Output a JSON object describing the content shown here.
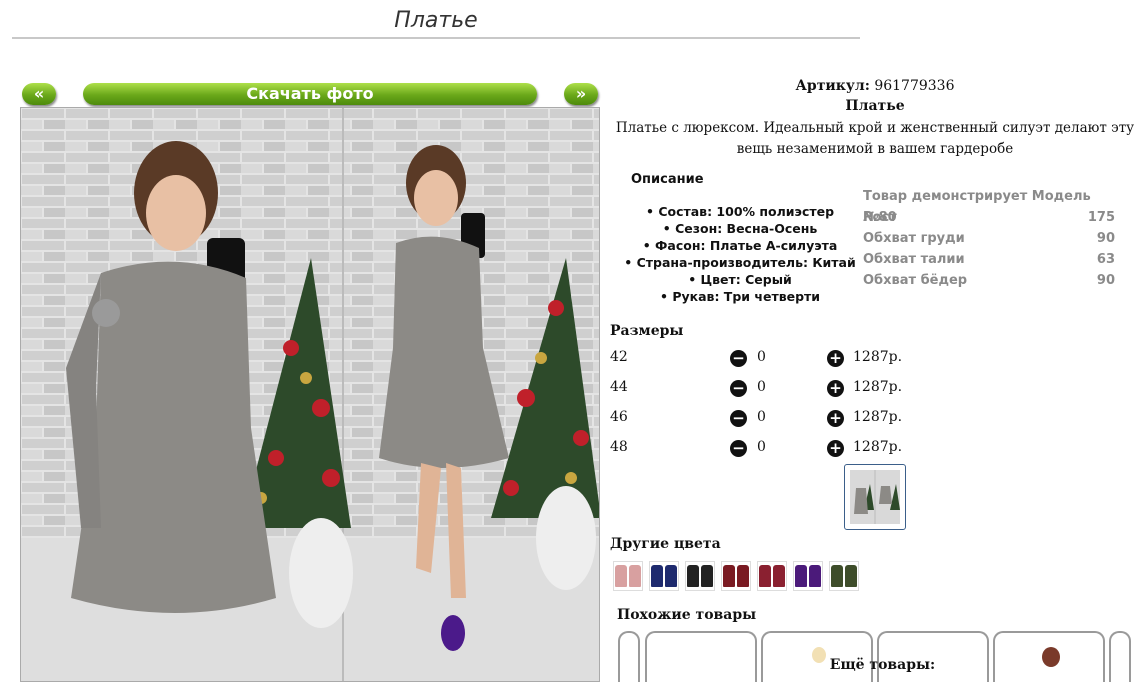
{
  "page": {
    "title": "Платье"
  },
  "gallery": {
    "prev_label": "«",
    "next_label": "»",
    "download_label": "Скачать фото"
  },
  "product": {
    "sku_label": "Артикул:",
    "sku_value": "961779336",
    "name": "Платье",
    "description": "Платье с люрексом. Идеальный крой и женственный силуэт делают эту вещь незаменимой в вашем гардеробе"
  },
  "attributes": {
    "heading": "Описание",
    "items": [
      "Состав: 100% полиэстер",
      "Сезон: Весна-Осень",
      "Фасон: Платье А-силуэта",
      "Страна-производитель: Китай",
      "Цвет: Серый",
      "Рукав: Три четверти"
    ]
  },
  "model": {
    "header": "Товар демонстрирует Модель №80",
    "rows": [
      {
        "label": "Рост",
        "value": "175"
      },
      {
        "label": "Обхват груди",
        "value": "90"
      },
      {
        "label": "Обхват талии",
        "value": "63"
      },
      {
        "label": "Обхват бёдер",
        "value": "90"
      }
    ]
  },
  "sizes": {
    "heading": "Размеры",
    "minus_symbol": "−",
    "plus_symbol": "+",
    "rows": [
      {
        "size": "42",
        "qty": "0",
        "price": "1287р."
      },
      {
        "size": "44",
        "qty": "0",
        "price": "1287р."
      },
      {
        "size": "46",
        "qty": "0",
        "price": "1287р."
      },
      {
        "size": "48",
        "qty": "0",
        "price": "1287р."
      }
    ]
  },
  "colors": {
    "heading": "Другие цвета",
    "swatches": [
      "#d8a0a0",
      "#1e2a6e",
      "#222222",
      "#7a1a22",
      "#8a2030",
      "#4b1a7a",
      "#3e4d2a"
    ]
  },
  "similar": {
    "heading": "Похожие товары"
  },
  "more": {
    "heading": "Ещё товары:"
  },
  "palette": {
    "accent_green": "#6aa81a",
    "dress_gray": "#8c8a86",
    "brick": "#d6d6d6",
    "tree_green": "#2d4a2a",
    "shoe_purple": "#4b1a8a"
  }
}
